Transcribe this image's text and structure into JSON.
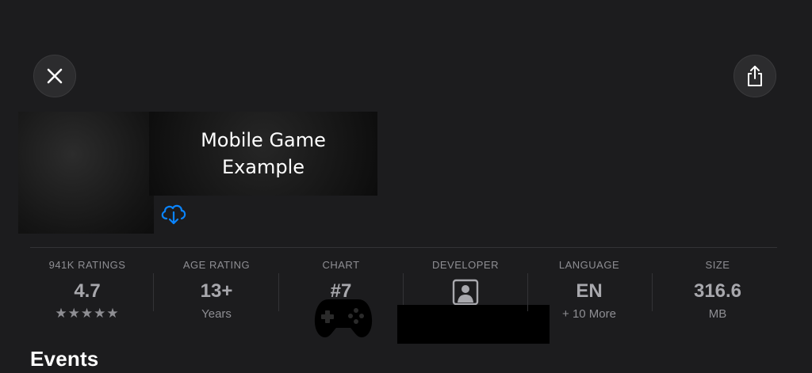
{
  "app": {
    "title": "Mobile Game Example"
  },
  "stats": {
    "ratings": {
      "label": "941K RATINGS",
      "value": "4.7",
      "stars": "★★★★★"
    },
    "age": {
      "label": "AGE RATING",
      "value": "13+",
      "sub": "Years"
    },
    "chart": {
      "label": "CHART",
      "value": "#7"
    },
    "developer": {
      "label": "DEVELOPER"
    },
    "language": {
      "label": "LANGUAGE",
      "value": "EN",
      "sub": "+ 10 More"
    },
    "size": {
      "label": "SIZE",
      "value": "316.6",
      "sub": "MB"
    }
  },
  "sections": {
    "events_title": "Events"
  },
  "icons": {
    "close": "close-icon",
    "share": "share-icon",
    "download": "cloud-download-icon",
    "developer": "person-icon",
    "chart": "game-controller-icon"
  },
  "colors": {
    "background": "#1c1c1e",
    "accent": "#0a84ff",
    "secondary_text": "#8e8e93"
  }
}
